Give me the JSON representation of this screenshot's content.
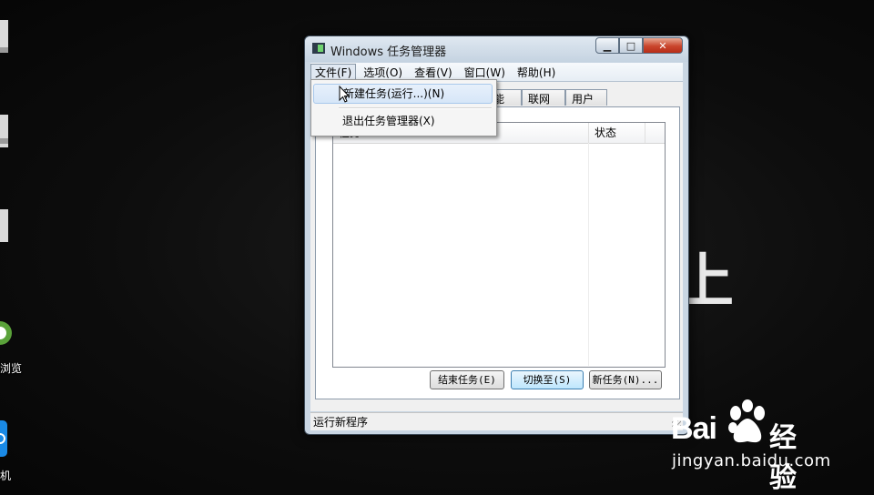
{
  "desktop": {
    "labels": [
      "浏览",
      "机"
    ]
  },
  "window": {
    "title": "Windows 任务管理器",
    "menu": [
      "文件(F)",
      "选项(O)",
      "查看(V)",
      "窗口(W)",
      "帮助(H)"
    ],
    "tabs": [
      "能",
      "联网",
      "用户"
    ],
    "list_columns": [
      "任务",
      "状态"
    ],
    "buttons": {
      "end_task": "结束任务(E)",
      "switch_to": "切换至(S)",
      "new_task": "新任务(N)..."
    },
    "status_text": "运行新程序"
  },
  "file_menu": {
    "items": [
      "新建任务(运行...)(N)",
      "退出任务管理器(X)"
    ]
  },
  "watermark": {
    "brand_latin": "Bai",
    "brand_cn": "经验",
    "url": "jingyan.baidu.com"
  },
  "background_text": "上"
}
